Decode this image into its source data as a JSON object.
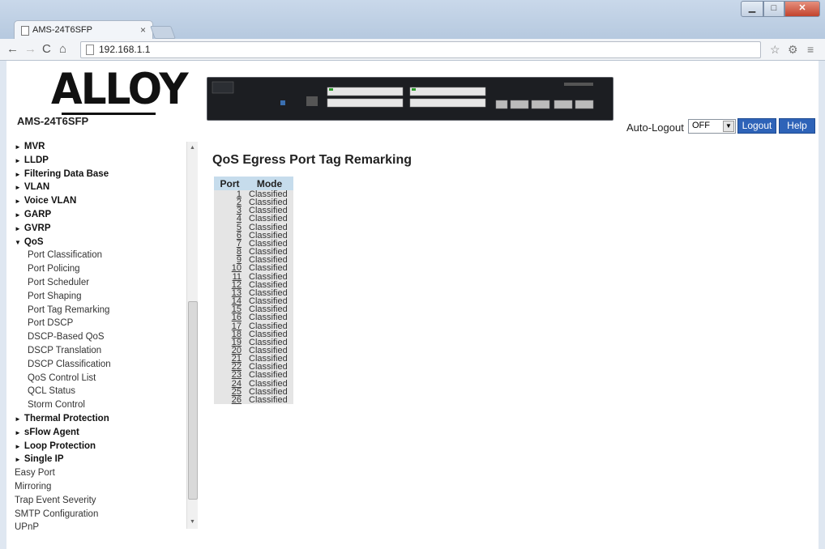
{
  "browser": {
    "tab_title": "AMS-24T6SFP",
    "url": "192.168.1.1"
  },
  "header": {
    "logo_text": "ALLOY",
    "model": "AMS-24T6SFP",
    "auto_logout_label": "Auto-Logout",
    "auto_logout_value": "OFF",
    "logout_label": "Logout",
    "help_label": "Help"
  },
  "sidebar": {
    "items": [
      {
        "label": "MVR",
        "kind": "top",
        "marker": "►"
      },
      {
        "label": "LLDP",
        "kind": "top",
        "marker": "►"
      },
      {
        "label": "Filtering Data Base",
        "kind": "top",
        "marker": "►"
      },
      {
        "label": "VLAN",
        "kind": "top",
        "marker": "►"
      },
      {
        "label": "Voice VLAN",
        "kind": "top",
        "marker": "►"
      },
      {
        "label": "GARP",
        "kind": "top",
        "marker": "►"
      },
      {
        "label": "GVRP",
        "kind": "top",
        "marker": "►"
      },
      {
        "label": "QoS",
        "kind": "top",
        "marker": "▼"
      },
      {
        "label": "Port Classification",
        "kind": "sub"
      },
      {
        "label": "Port Policing",
        "kind": "sub"
      },
      {
        "label": "Port Scheduler",
        "kind": "sub"
      },
      {
        "label": "Port Shaping",
        "kind": "sub"
      },
      {
        "label": "Port Tag Remarking",
        "kind": "sub"
      },
      {
        "label": "Port DSCP",
        "kind": "sub"
      },
      {
        "label": "DSCP-Based QoS",
        "kind": "sub"
      },
      {
        "label": "DSCP Translation",
        "kind": "sub"
      },
      {
        "label": "DSCP Classification",
        "kind": "sub"
      },
      {
        "label": "QoS Control List",
        "kind": "sub"
      },
      {
        "label": "QCL Status",
        "kind": "sub"
      },
      {
        "label": "Storm Control",
        "kind": "sub"
      },
      {
        "label": "Thermal Protection",
        "kind": "top",
        "marker": "►"
      },
      {
        "label": "sFlow Agent",
        "kind": "top",
        "marker": "►"
      },
      {
        "label": "Loop Protection",
        "kind": "top",
        "marker": "►"
      },
      {
        "label": "Single IP",
        "kind": "top",
        "marker": "►"
      },
      {
        "label": "Easy Port",
        "kind": "plain"
      },
      {
        "label": "Mirroring",
        "kind": "plain"
      },
      {
        "label": "Trap Event Severity",
        "kind": "plain"
      },
      {
        "label": "SMTP Configuration",
        "kind": "plain"
      },
      {
        "label": "UPnP",
        "kind": "plain"
      }
    ]
  },
  "main": {
    "title": "QoS Egress Port Tag Remarking",
    "columns": [
      "Port",
      "Mode"
    ],
    "rows": [
      {
        "port": "1",
        "mode": "Classified"
      },
      {
        "port": "2",
        "mode": "Classified"
      },
      {
        "port": "3",
        "mode": "Classified"
      },
      {
        "port": "4",
        "mode": "Classified"
      },
      {
        "port": "5",
        "mode": "Classified"
      },
      {
        "port": "6",
        "mode": "Classified"
      },
      {
        "port": "7",
        "mode": "Classified"
      },
      {
        "port": "8",
        "mode": "Classified"
      },
      {
        "port": "9",
        "mode": "Classified"
      },
      {
        "port": "10",
        "mode": "Classified"
      },
      {
        "port": "11",
        "mode": "Classified"
      },
      {
        "port": "12",
        "mode": "Classified"
      },
      {
        "port": "13",
        "mode": "Classified"
      },
      {
        "port": "14",
        "mode": "Classified"
      },
      {
        "port": "15",
        "mode": "Classified"
      },
      {
        "port": "16",
        "mode": "Classified"
      },
      {
        "port": "17",
        "mode": "Classified"
      },
      {
        "port": "18",
        "mode": "Classified"
      },
      {
        "port": "19",
        "mode": "Classified"
      },
      {
        "port": "20",
        "mode": "Classified"
      },
      {
        "port": "21",
        "mode": "Classified"
      },
      {
        "port": "22",
        "mode": "Classified"
      },
      {
        "port": "23",
        "mode": "Classified"
      },
      {
        "port": "24",
        "mode": "Classified"
      },
      {
        "port": "25",
        "mode": "Classified"
      },
      {
        "port": "26",
        "mode": "Classified"
      }
    ]
  },
  "colors": {
    "button_blue": "#2e63b8",
    "table_header": "#c6dcec",
    "row_background": "#e5e5e5"
  }
}
